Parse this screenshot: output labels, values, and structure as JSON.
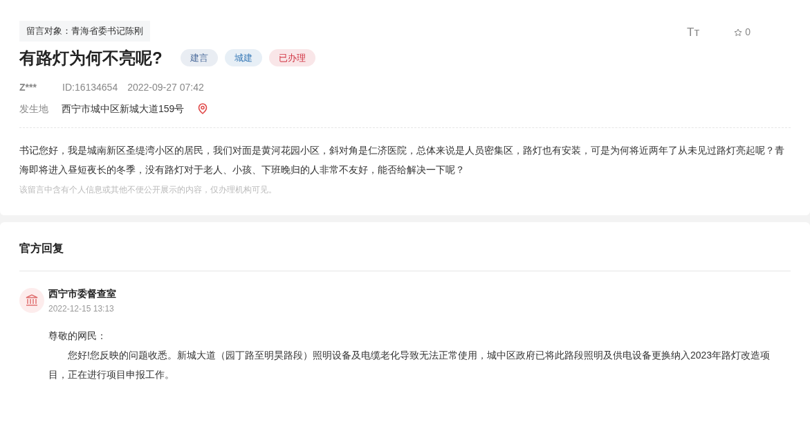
{
  "recipient": "留言对象：青海省委书记陈刚",
  "font_size_icon": "Tт",
  "favorite": {
    "count": "0"
  },
  "title": "有路灯为何不亮呢?",
  "tags": [
    {
      "label": "建言",
      "color": "#4a6a9a"
    },
    {
      "label": "城建",
      "color": "#3b7cb8"
    },
    {
      "label": "已办理",
      "color": "#d0303f"
    }
  ],
  "author": "Z***",
  "id": "ID:16134654",
  "date": "2022-09-27 07:42",
  "location": {
    "label": "发生地",
    "value": "西宁市城中区新城大道159号"
  },
  "body": "书记您好，我是城南新区圣缇湾小区的居民，我们对面是黄河花园小区，斜对角是仁济医院，总体来说是人员密集区，路灯也有安装，可是为何将近两年了从未见过路灯亮起呢？青海即将进入昼短夜长的冬季，没有路灯对于老人、小孩、下班晚归的人非常不友好，能否给解决一下呢？",
  "privacy_note": "该留言中含有个人信息或其他不便公开展示的内容，仅办理机构可见。",
  "reply": {
    "heading": "官方回复",
    "org": "西宁市委督查室",
    "date": "2022-12-15 13:13",
    "greeting": "尊敬的网民：",
    "text": "您好!您反映的问题收悉。新城大道（园丁路至明昊路段）照明设备及电缆老化导致无法正常使用，城中区政府已将此路段照明及供电设备更换纳入2023年路灯改造项目，正在进行项目申报工作。"
  }
}
